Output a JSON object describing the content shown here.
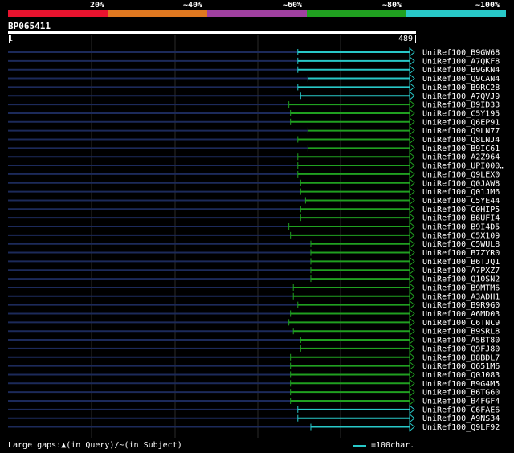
{
  "legend": {
    "labels": [
      "20%",
      "~40%",
      "~60%",
      "~80%",
      "~100%"
    ],
    "colors": [
      "#e8132e",
      "#e07820",
      "#a040a0",
      "#20a020",
      "#28c8c8"
    ]
  },
  "query": {
    "id": "BP065411",
    "start": "1",
    "end": "489"
  },
  "hits": [
    {
      "label": "UniRef100_B9GW68",
      "start": 0.713,
      "color": "#28c8c8"
    },
    {
      "label": "UniRef100_A7QKF8",
      "start": 0.713,
      "color": "#28c8c8"
    },
    {
      "label": "UniRef100_B9GKN4",
      "start": 0.713,
      "color": "#28c8c8"
    },
    {
      "label": "UniRef100_Q9CAN4",
      "start": 0.738,
      "color": "#28c8c8"
    },
    {
      "label": "UniRef100_B9RC28",
      "start": 0.713,
      "color": "#28c8c8"
    },
    {
      "label": "UniRef100_A7QVJ9",
      "start": 0.72,
      "color": "#28c8c8"
    },
    {
      "label": "UniRef100_B9ID33",
      "start": 0.691,
      "color": "#20a020"
    },
    {
      "label": "UniRef100_C5Y195",
      "start": 0.695,
      "color": "#20a020"
    },
    {
      "label": "UniRef100_Q6EP91",
      "start": 0.695,
      "color": "#20a020"
    },
    {
      "label": "UniRef100_Q9LN77",
      "start": 0.738,
      "color": "#20a020"
    },
    {
      "label": "UniRef100_Q8LNJ4",
      "start": 0.713,
      "color": "#20a020"
    },
    {
      "label": "UniRef100_B9IC61",
      "start": 0.738,
      "color": "#20a020"
    },
    {
      "label": "UniRef100_A2Z964",
      "start": 0.713,
      "color": "#20a020"
    },
    {
      "label": "UniRef100_UPI000…",
      "start": 0.713,
      "color": "#20a020"
    },
    {
      "label": "UniRef100_Q9LEX0",
      "start": 0.713,
      "color": "#20a020"
    },
    {
      "label": "UniRef100_Q0JAW8",
      "start": 0.72,
      "color": "#20a020"
    },
    {
      "label": "UniRef100_Q01JM6",
      "start": 0.72,
      "color": "#20a020"
    },
    {
      "label": "UniRef100_C5YE44",
      "start": 0.732,
      "color": "#20a020"
    },
    {
      "label": "UniRef100_C0HIP5",
      "start": 0.72,
      "color": "#20a020"
    },
    {
      "label": "UniRef100_B6UFI4",
      "start": 0.72,
      "color": "#20a020"
    },
    {
      "label": "UniRef100_B9I4D5",
      "start": 0.691,
      "color": "#20a020"
    },
    {
      "label": "UniRef100_C5X109",
      "start": 0.695,
      "color": "#20a020"
    },
    {
      "label": "UniRef100_C5WUL8",
      "start": 0.745,
      "color": "#20a020"
    },
    {
      "label": "UniRef100_B7ZYR0",
      "start": 0.745,
      "color": "#20a020"
    },
    {
      "label": "UniRef100_B6TJQ1",
      "start": 0.745,
      "color": "#20a020"
    },
    {
      "label": "UniRef100_A7PXZ7",
      "start": 0.745,
      "color": "#20a020"
    },
    {
      "label": "UniRef100_Q10SN2",
      "start": 0.745,
      "color": "#20a020"
    },
    {
      "label": "UniRef100_B9MTM6",
      "start": 0.702,
      "color": "#20a020"
    },
    {
      "label": "UniRef100_A3ADH1",
      "start": 0.702,
      "color": "#20a020"
    },
    {
      "label": "UniRef100_B9R9G0",
      "start": 0.713,
      "color": "#20a020"
    },
    {
      "label": "UniRef100_A6MD03",
      "start": 0.695,
      "color": "#20a020"
    },
    {
      "label": "UniRef100_C6TNC9",
      "start": 0.691,
      "color": "#20a020"
    },
    {
      "label": "UniRef100_B9SRL8",
      "start": 0.702,
      "color": "#20a020"
    },
    {
      "label": "UniRef100_A5BT80",
      "start": 0.72,
      "color": "#20a020"
    },
    {
      "label": "UniRef100_Q9FJ80",
      "start": 0.72,
      "color": "#20a020"
    },
    {
      "label": "UniRef100_B8BDL7",
      "start": 0.695,
      "color": "#20a020"
    },
    {
      "label": "UniRef100_Q651M6",
      "start": 0.695,
      "color": "#20a020"
    },
    {
      "label": "UniRef100_Q0J083",
      "start": 0.695,
      "color": "#20a020"
    },
    {
      "label": "UniRef100_B9G4M5",
      "start": 0.695,
      "color": "#20a020"
    },
    {
      "label": "UniRef100_B6TG60",
      "start": 0.695,
      "color": "#20a020"
    },
    {
      "label": "UniRef100_B4FGF4",
      "start": 0.695,
      "color": "#20a020"
    },
    {
      "label": "UniRef100_C6FAE6",
      "start": 0.713,
      "color": "#28c8c8"
    },
    {
      "label": "UniRef100_A9NS34",
      "start": 0.713,
      "color": "#28c8c8"
    },
    {
      "label": "UniRef100_Q9LF92",
      "start": 0.745,
      "color": "#28c8c8"
    }
  ],
  "footer": {
    "gaps_text": "Large gaps:▲(in Query)/~(in Subject)",
    "scale_text": "=100char."
  }
}
